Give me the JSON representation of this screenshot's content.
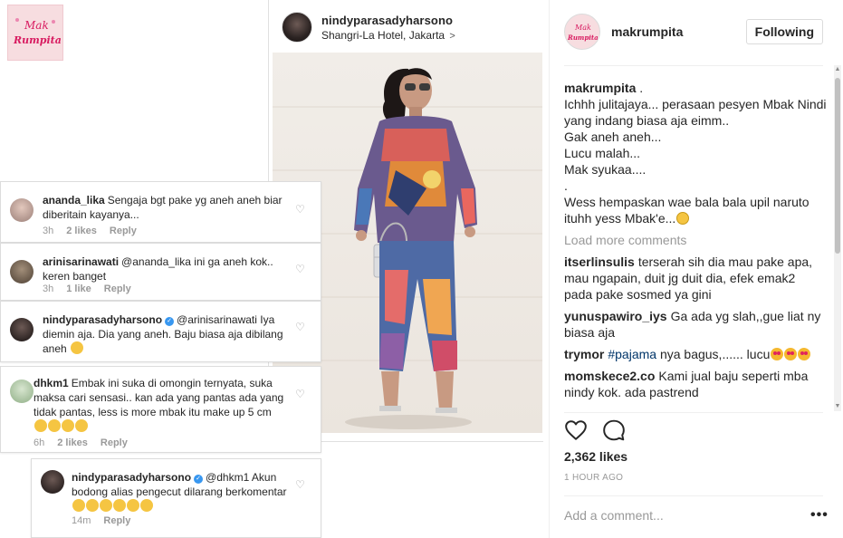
{
  "collage": {
    "logo_text_top": "Mak",
    "logo_text_bottom": "Rumpita",
    "post_card": {
      "username": "nindyparasadyharsono",
      "location": "Shangri-La Hotel, Jakarta",
      "location_chevron": ">"
    },
    "comment_boxes": [
      {
        "username": "ananda_lika",
        "text": "Sengaja bgt pake yg aneh aneh biar diberitain kayanya...",
        "time": "3h",
        "likes": "2 likes",
        "reply": "Reply",
        "verified": false
      },
      {
        "username": "arinisarinawati",
        "text": "@ananda_lika ini ga aneh kok.. keren banget",
        "time": "3h",
        "likes": "1 like",
        "reply": "Reply",
        "verified": false
      },
      {
        "username": "nindyparasadyharsono",
        "text": "@arinisarinawati Iya diemin aja. Dia yang aneh. Baju biasa aja dibilang aneh",
        "time": "",
        "likes": "",
        "reply": "",
        "verified": true
      },
      {
        "username": "dhkm1",
        "text": "Embak ini suka di omongin ternyata, suka maksa cari sensasi.. kan ada yang pantas ada yang tidak pantas, less is more mbak itu make up 5 cm",
        "time": "6h",
        "likes": "2 likes",
        "reply": "Reply",
        "verified": false
      },
      {
        "username": "nindyparasadyharsono",
        "text": "@dhkm1 Akun bodong alias pengecut dilarang berkomentar",
        "time": "14m",
        "likes": "",
        "reply": "Reply",
        "verified": true
      }
    ]
  },
  "panel": {
    "header": {
      "username": "makrumpita",
      "follow_label": "Following"
    },
    "caption": {
      "username": "makrumpita",
      "username_suffix": " .",
      "lines": [
        "Ichhh julitajaya... perasaan pesyen Mbak Nindi yang indang biasa aja eimm..",
        "Gak aneh aneh...",
        "Lucu malah...",
        "Mak syukaa....",
        ".",
        "Wess hempaskan wae bala bala upil naruto ituhh yess Mbak'e..."
      ]
    },
    "load_more": "Load more comments",
    "comments": [
      {
        "username": "itserlinsulis",
        "text": "terserah sih dia mau pake apa, mau ngapain, duit jg duit dia, efek emak2 pada pake sosmed ya gini"
      },
      {
        "username": "yunuspawiro_iys",
        "text": "Ga ada yg slah,,gue liat ny biasa aja"
      },
      {
        "username": "trymor",
        "hashtag": "#pajama",
        "text": " nya bagus,...... lucu"
      },
      {
        "username": "momskece2.co",
        "text": "Kami jual baju seperti mba nindy kok. ada pastrend"
      }
    ],
    "likes": "2,362 likes",
    "time": "1 HOUR AGO",
    "add_comment_placeholder": "Add a comment...",
    "more_options": "•••"
  },
  "icons": {
    "like": "heart-icon",
    "comment": "comment-icon",
    "scroll_up": "▲",
    "scroll_down": "▼"
  }
}
